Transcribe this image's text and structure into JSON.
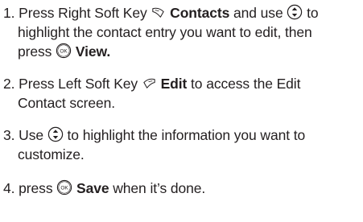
{
  "steps": [
    {
      "number": "1.",
      "line1_pre": "Press Right Soft Key",
      "line1_key": "Contacts",
      "line1_mid": "and use",
      "line1_post": "to",
      "line2": "highlight the contact entry you want to edit, then",
      "line3_pre": "press",
      "line3_key": "View."
    },
    {
      "number": "2.",
      "line1_pre": "Press Left Soft Key",
      "line1_key": "Edit",
      "line1_post": "to access the Edit",
      "line2": "Contact screen."
    },
    {
      "number": "3.",
      "line1_pre": "Use",
      "line1_post": "to highlight the information you want to",
      "line2": "customize."
    },
    {
      "number": "4.",
      "line1_pre": "press",
      "line1_key": "Save",
      "line1_post": "when it’s done."
    }
  ],
  "icons": {
    "right_soft_key": "right-soft-key-icon",
    "left_soft_key": "left-soft-key-icon",
    "navigation_key": "navigation-key-icon",
    "ok_key": "ok-key-icon",
    "ok_label": "OK"
  }
}
